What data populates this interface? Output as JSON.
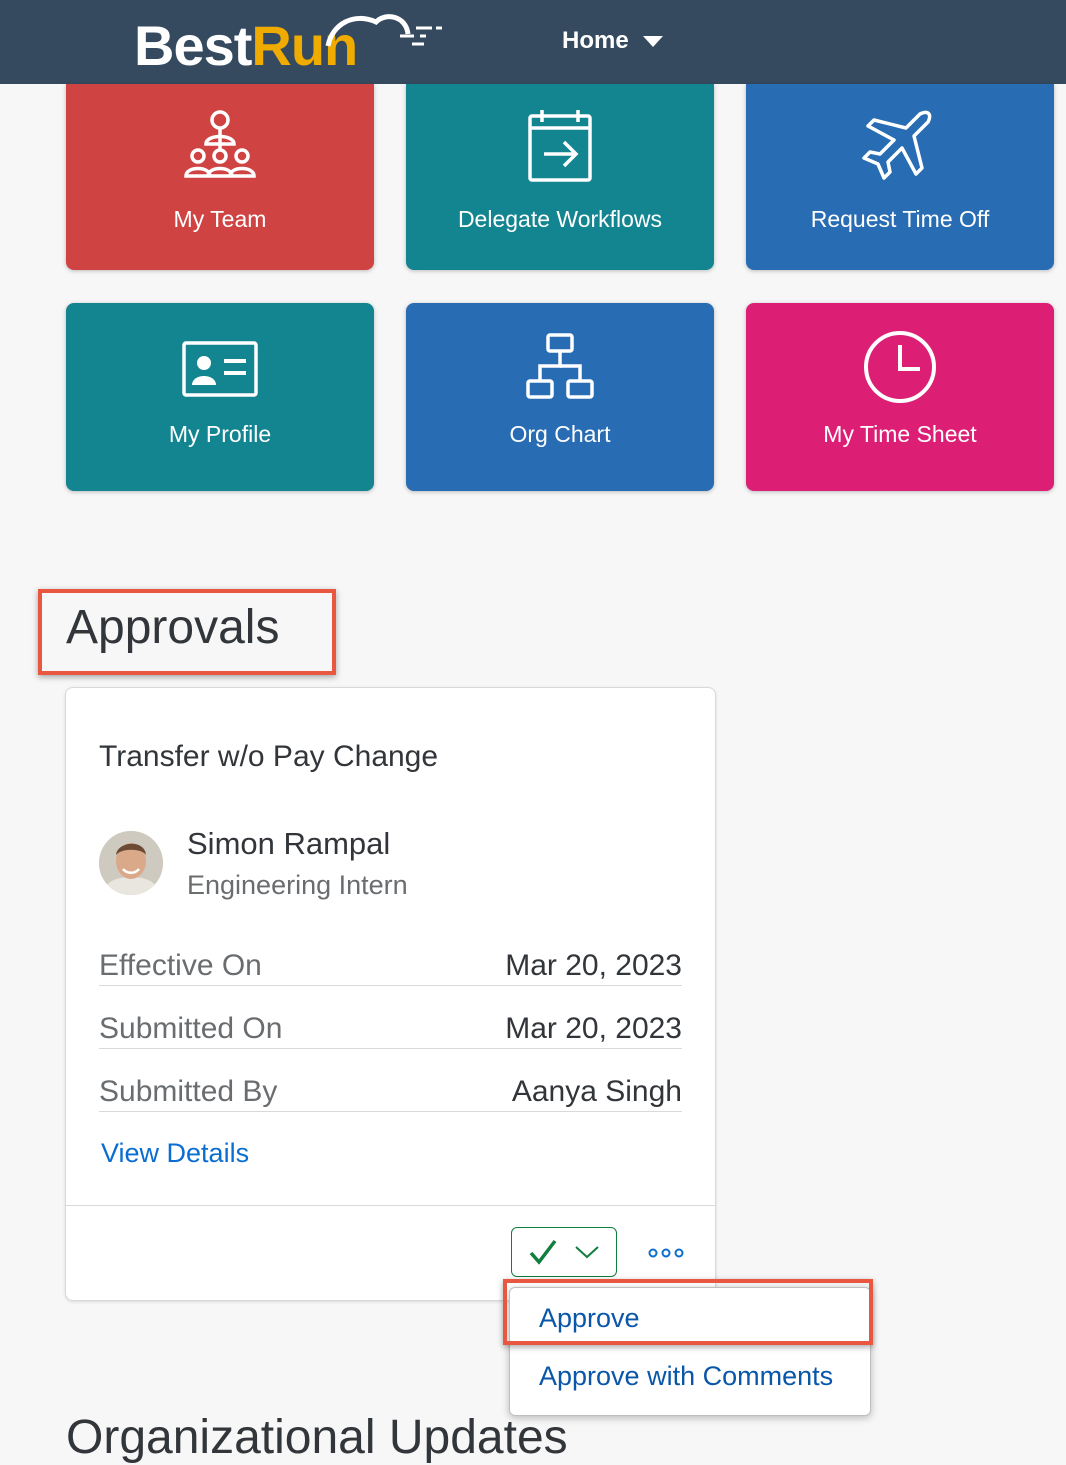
{
  "header": {
    "logo": {
      "part1": "Best",
      "part2": "Run"
    },
    "menu_label": "Home"
  },
  "tiles": [
    {
      "label": "My Team",
      "icon": "my-team-icon",
      "color": "#d04343"
    },
    {
      "label": "Delegate Workflows",
      "icon": "delegate-workflows-icon",
      "color": "#138590"
    },
    {
      "label": "Request Time Off",
      "icon": "airplane-icon",
      "color": "#286cb3"
    },
    {
      "label": "My Profile",
      "icon": "profile-card-icon",
      "color": "#138590"
    },
    {
      "label": "Org Chart",
      "icon": "org-chart-icon",
      "color": "#286cb3"
    },
    {
      "label": "My Time Sheet",
      "icon": "clock-icon",
      "color": "#dc1f75"
    }
  ],
  "approvals": {
    "title": "Approvals",
    "card": {
      "title": "Transfer w/o Pay Change",
      "person": {
        "name": "Simon Rampal",
        "role": "Engineering Intern"
      },
      "fields": [
        {
          "label": "Effective On",
          "value": "Mar 20, 2023"
        },
        {
          "label": "Submitted On",
          "value": "Mar 20, 2023"
        },
        {
          "label": "Submitted By",
          "value": "Aanya Singh"
        }
      ],
      "link": "View Details"
    },
    "menu": {
      "items": [
        "Approve",
        "Approve with Comments"
      ]
    }
  },
  "next_section": {
    "title": "Organizational Updates"
  },
  "colors": {
    "header": "#354a5f",
    "accent": "#0a6ed1",
    "highlight": "#e8573f",
    "approve": "#107e3e"
  }
}
